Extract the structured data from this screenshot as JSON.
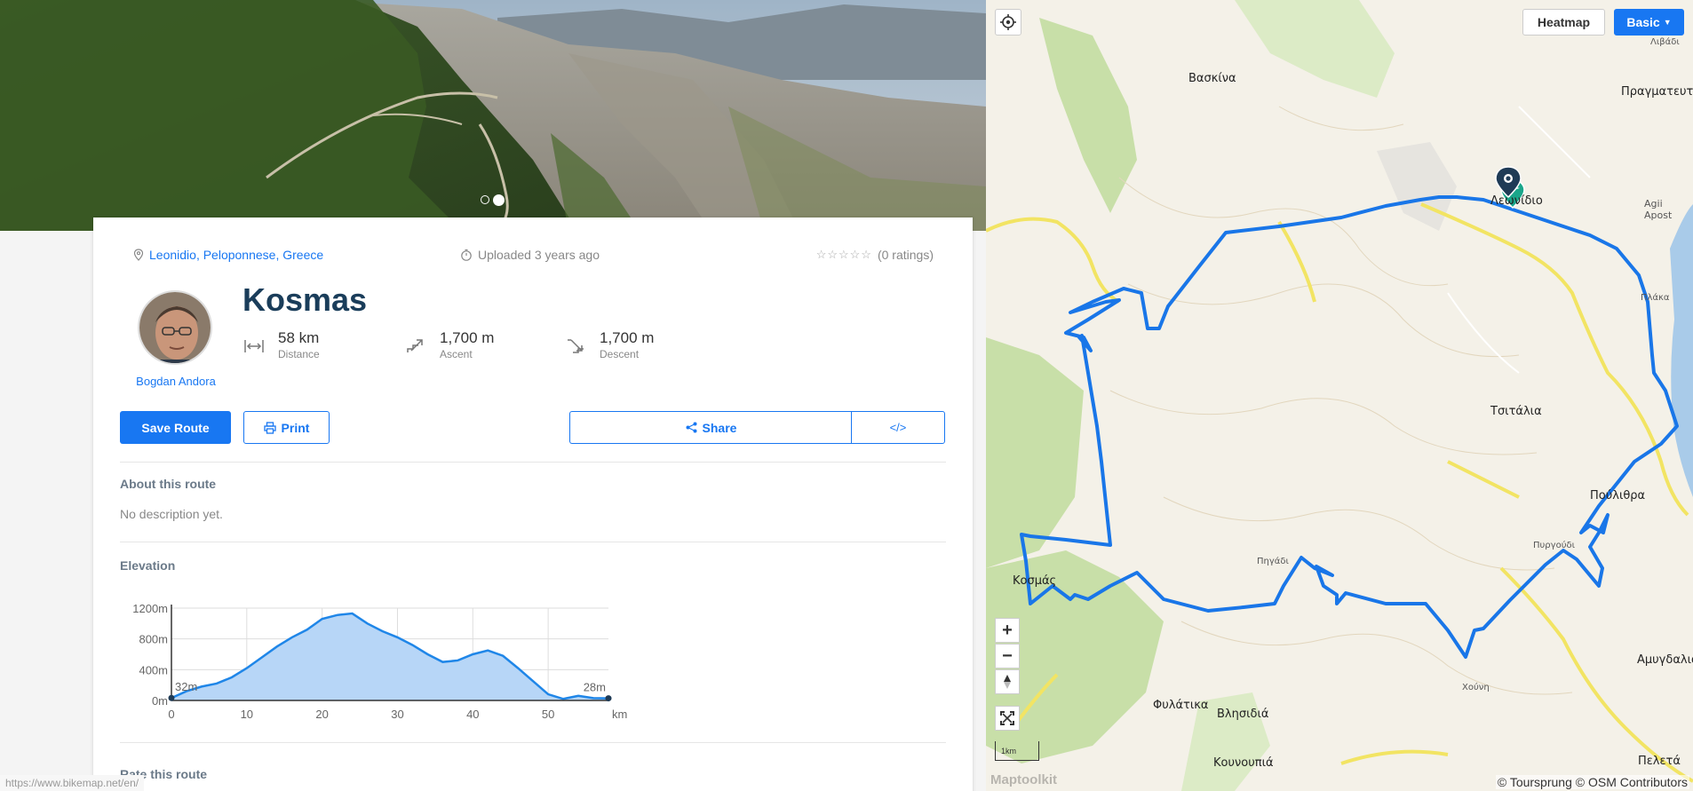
{
  "route": {
    "location": "Leonidio, Peloponnese, Greece",
    "uploaded": "Uploaded 3 years ago",
    "ratings": "(0 ratings)",
    "title": "Kosmas",
    "author": "Bogdan Andora",
    "stats": [
      {
        "value": "58 km",
        "label": "Distance",
        "icon": "distance-icon"
      },
      {
        "value": "1,700 m",
        "label": "Ascent",
        "icon": "ascent-icon"
      },
      {
        "value": "1,700 m",
        "label": "Descent",
        "icon": "descent-icon"
      }
    ]
  },
  "actions": {
    "save": "Save Route",
    "print": "Print",
    "share": "Share",
    "embed": "</>"
  },
  "about": {
    "title": "About this route",
    "text": "No description yet."
  },
  "elevation": {
    "title": "Elevation",
    "start_label": "32m",
    "end_label": "28m",
    "x_unit": "km"
  },
  "rate": {
    "title": "Rate this route"
  },
  "gallery": {
    "slides": 2,
    "active": 2
  },
  "map": {
    "heatmap_label": "Heatmap",
    "basic_label": "Basic",
    "scale_label": "1km",
    "attribution": "© Toursprung © OSM Contributors",
    "logo": "Maptoolkit",
    "places": [
      {
        "name": "Βασκίνα"
      },
      {
        "name": "Πραγματευτή"
      },
      {
        "name": "Λιβάδι"
      },
      {
        "name": "Λεωνίδιο"
      },
      {
        "name": "Agii Apost"
      },
      {
        "name": "Πλάκα"
      },
      {
        "name": "Τσιτάλια"
      },
      {
        "name": "Πούλιθρα"
      },
      {
        "name": "Πυργούδι"
      },
      {
        "name": "Πηγάδι"
      },
      {
        "name": "Κοσμάς"
      },
      {
        "name": "Χούνη"
      },
      {
        "name": "Αμυγδαλιά"
      },
      {
        "name": "Φυλάτικα"
      },
      {
        "name": "Βλησιδιά"
      },
      {
        "name": "Κουνουπιά"
      },
      {
        "name": "Πελετά"
      }
    ]
  },
  "status_url": "https://www.bikemap.net/en/",
  "chart_data": {
    "type": "area",
    "title": "Elevation",
    "xlabel": "km",
    "ylabel": "",
    "xlim": [
      0,
      58
    ],
    "ylim": [
      0,
      1200
    ],
    "x_ticks": [
      0,
      10,
      20,
      30,
      40,
      50
    ],
    "y_ticks": [
      0,
      400,
      800,
      1200
    ],
    "y_tick_labels": [
      "0m",
      "400m",
      "800m",
      "1200m"
    ],
    "grid": true,
    "series": [
      {
        "x": [
          0,
          2,
          4,
          6,
          8,
          10,
          12,
          14,
          16,
          18,
          20,
          22,
          24,
          26,
          28,
          30,
          32,
          34,
          36,
          38,
          40,
          42,
          44,
          46,
          48,
          50,
          52,
          53,
          54,
          56,
          58
        ],
        "y": [
          32,
          120,
          180,
          220,
          300,
          420,
          560,
          700,
          820,
          920,
          1060,
          1110,
          1130,
          1000,
          900,
          820,
          720,
          600,
          500,
          520,
          600,
          650,
          580,
          420,
          250,
          80,
          20,
          40,
          60,
          30,
          28
        ]
      }
    ]
  }
}
